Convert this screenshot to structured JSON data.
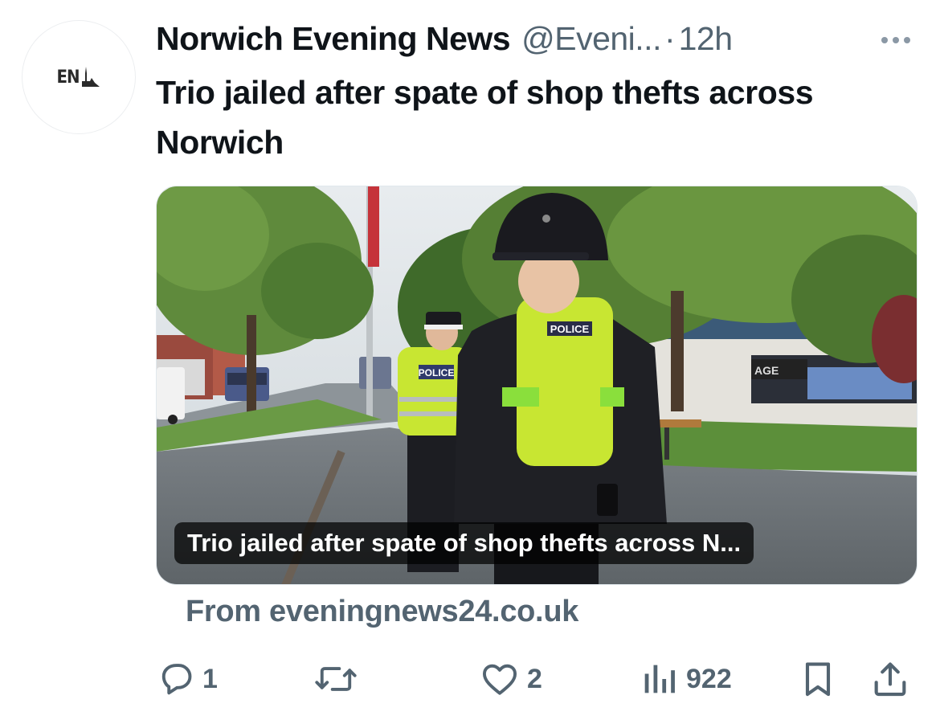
{
  "tweet": {
    "avatar_text": "EN",
    "author_name": "Norwich Evening News",
    "author_handle": "@Eveni...",
    "separator": "·",
    "time": "12h",
    "text": "Trio jailed after spate of shop thefts across Norwich"
  },
  "card": {
    "caption": "Trio jailed after spate of shop thefts across N...",
    "vest_text": "POLICE",
    "vest_text_2": "POLICE",
    "store_sign": "AGE",
    "source": "From eveningnews24.co.uk"
  },
  "actions": {
    "reply_count": "1",
    "like_count": "2",
    "views_count": "922"
  },
  "icons": {
    "more": "more-dots-icon",
    "reply": "reply-bubble-icon",
    "retweet": "retweet-icon",
    "like": "heart-icon",
    "views": "analytics-bars-icon",
    "bookmark": "bookmark-icon",
    "share": "share-upload-icon"
  },
  "colors": {
    "text_primary": "#0f1419",
    "text_secondary": "#536471",
    "hi_vis": "#c8e632"
  }
}
